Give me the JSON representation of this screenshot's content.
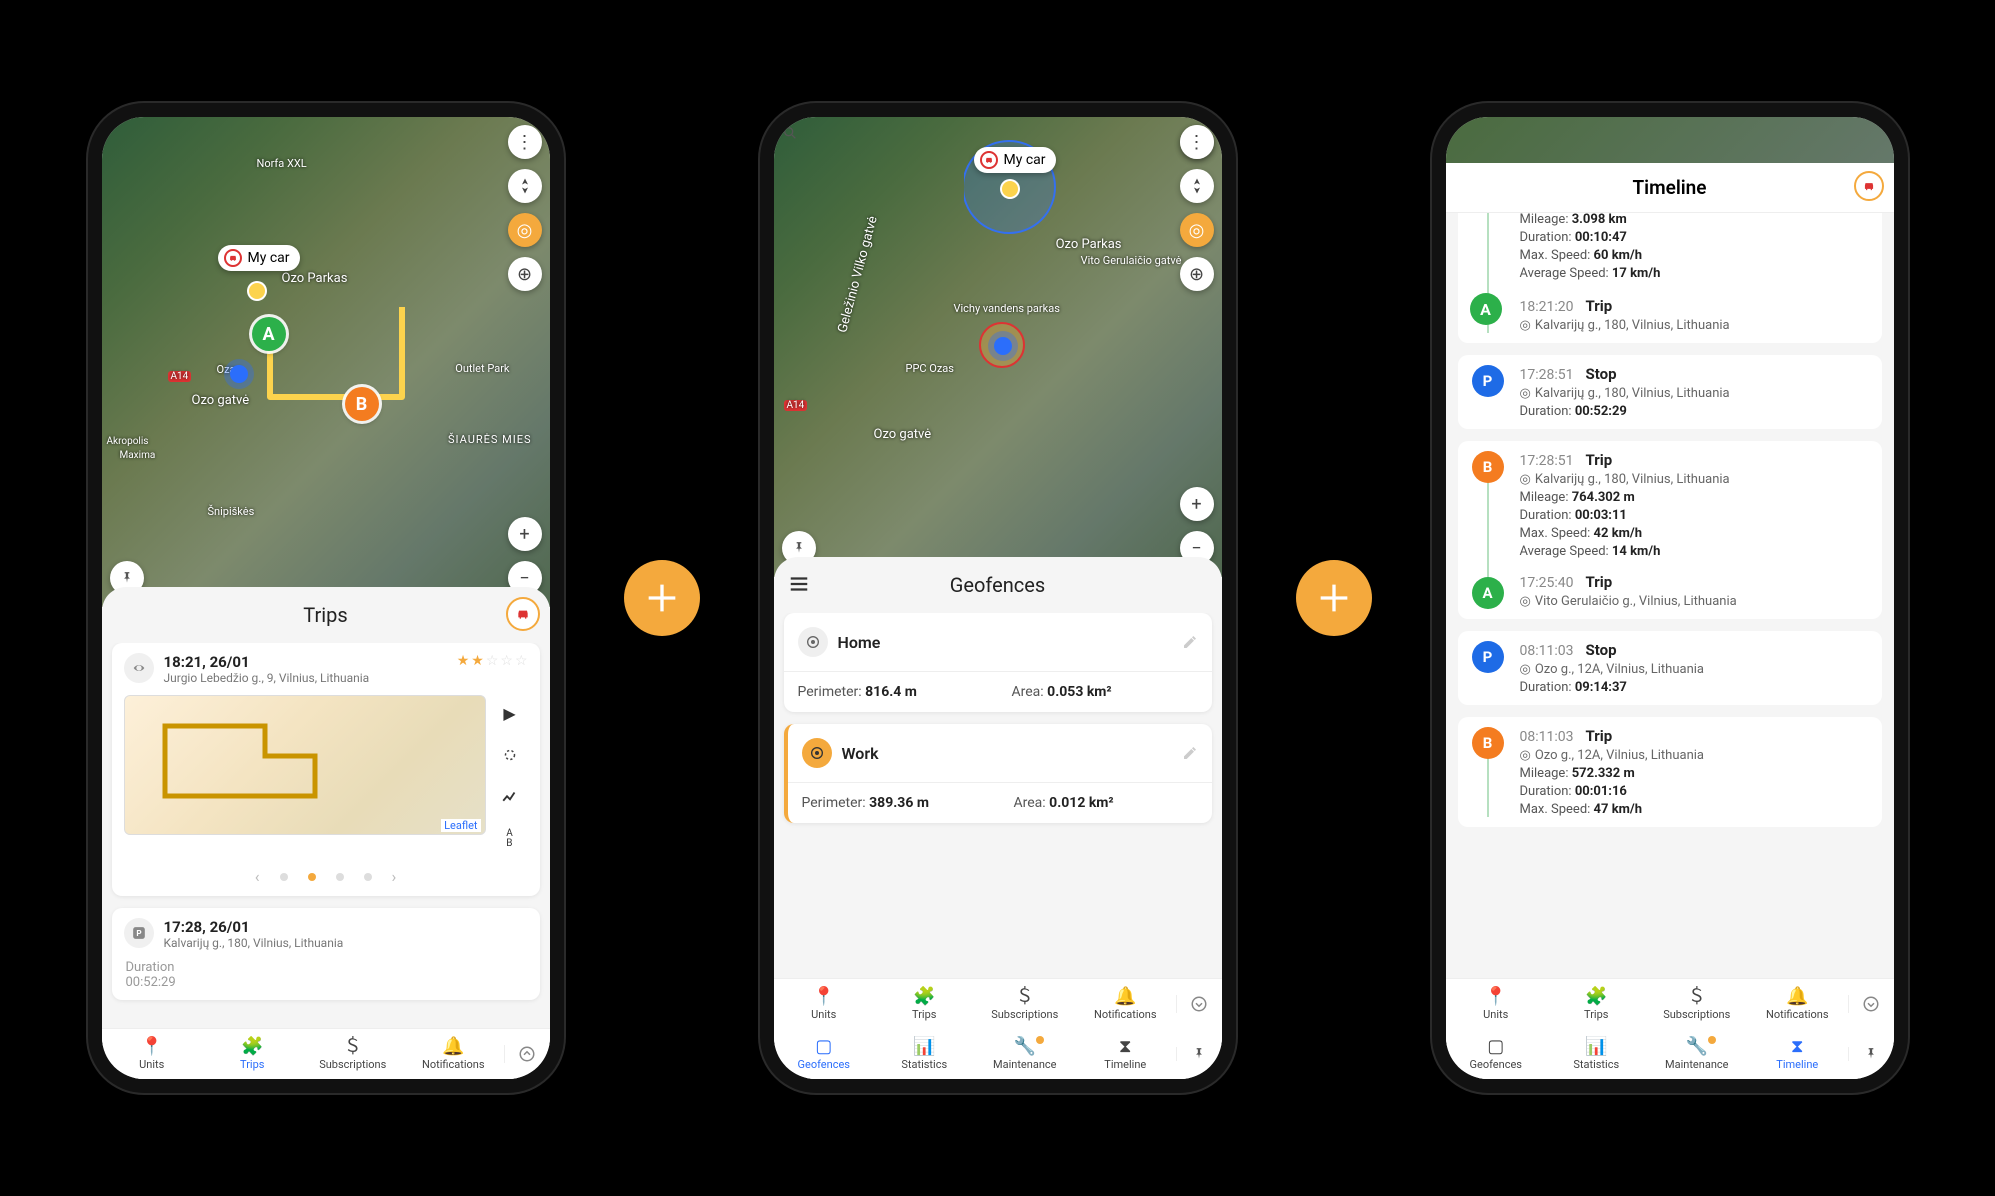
{
  "phone1": {
    "unit_bubble": "My car",
    "panel_title": "Trips",
    "map_labels": {
      "ozo": "Ozo Parkas",
      "ozas": "Ozas",
      "ozo_g": "Ozo gatvė",
      "outlet": "Outlet Park",
      "snip": "Šnipiškės",
      "akropolis": "Akropolis",
      "maxima": "Maxima",
      "siaures": "ŠIAURĖS MIES",
      "norfa": "Norfa XXL",
      "a14": "A14"
    },
    "trip1": {
      "time": "18:21, 26/01",
      "addr": "Jurgio Lebedžio g., 9, Vilnius, Lithuania",
      "leaflet": "Leaflet",
      "ab": "A\nB"
    },
    "trip2": {
      "time": "17:28, 26/01",
      "addr": "Kalvarijų g., 180, Vilnius, Lithuania",
      "duration_label": "Duration",
      "duration_value": "00:52:29"
    },
    "nav": {
      "units": "Units",
      "trips": "Trips",
      "subs": "Subscriptions",
      "notif": "Notifications"
    }
  },
  "phone2": {
    "unit_bubble": "My car",
    "panel_title": "Geofences",
    "map_labels": {
      "ozo": "Ozo Parkas",
      "vichy": "Vichy vandens parkas",
      "ppc": "PPC Ozas",
      "ozo_g": "Ozo gatvė",
      "gelezinio": "Geležinio Vilko gatvė",
      "vito": "Vito Gerulaičio gatvė",
      "a14": "A14"
    },
    "geo1": {
      "name": "Home",
      "peri_label": "Perimeter: ",
      "peri_val": "816.4 m",
      "area_label": "Area: ",
      "area_val": "0.053 km²"
    },
    "geo2": {
      "name": "Work",
      "peri_label": "Perimeter: ",
      "peri_val": "389.36 m",
      "area_label": "Area: ",
      "area_val": "0.012 km²"
    },
    "nav": {
      "units": "Units",
      "trips": "Trips",
      "subs": "Subscriptions",
      "notif": "Notifications",
      "geof": "Geofences",
      "stats": "Statistics",
      "maint": "Maintenance",
      "timeline": "Timeline"
    }
  },
  "phone3": {
    "header": "Timeline",
    "partial": {
      "mileage_l": "Mileage: ",
      "mileage_v": "3.098 km",
      "duration_l": "Duration: ",
      "duration_v": "00:10:47",
      "maxspeed_l": "Max. Speed: ",
      "maxspeed_v": "60 km/h",
      "avgspeed_l": "Average Speed: ",
      "avgspeed_v": "17 km/h"
    },
    "ev1": {
      "time": "18:21:20",
      "type": "Trip",
      "addr": "Kalvarijų g., 180, Vilnius, Lithuania"
    },
    "ev2": {
      "time": "17:28:51",
      "type": "Stop",
      "addr": "Kalvarijų g., 180, Vilnius, Lithuania",
      "dur_l": "Duration: ",
      "dur_v": "00:52:29"
    },
    "ev3": {
      "time": "17:28:51",
      "type": "Trip",
      "addr": "Kalvarijų g., 180, Vilnius, Lithuania",
      "mileage_l": "Mileage: ",
      "mileage_v": "764.302 m",
      "duration_l": "Duration: ",
      "duration_v": "00:03:11",
      "maxspeed_l": "Max. Speed: ",
      "maxspeed_v": "42 km/h",
      "avgspeed_l": "Average Speed: ",
      "avgspeed_v": "14 km/h"
    },
    "ev3b": {
      "time": "17:25:40",
      "type": "Trip",
      "addr": "Vito Gerulaičio g., Vilnius, Lithuania"
    },
    "ev4": {
      "time": "08:11:03",
      "type": "Stop",
      "addr": "Ozo g., 12A, Vilnius, Lithuania",
      "dur_l": "Duration: ",
      "dur_v": "09:14:37"
    },
    "ev5": {
      "time": "08:11:03",
      "type": "Trip",
      "addr": "Ozo g., 12A, Vilnius, Lithuania",
      "mileage_l": "Mileage: ",
      "mileage_v": "572.332 m",
      "duration_l": "Duration: ",
      "duration_v": "00:01:16",
      "maxspeed_l": "Max. Speed: ",
      "maxspeed_v": "47 km/h"
    },
    "nav": {
      "units": "Units",
      "trips": "Trips",
      "subs": "Subscriptions",
      "notif": "Notifications",
      "geof": "Geofences",
      "stats": "Statistics",
      "maint": "Maintenance",
      "timeline": "Timeline"
    }
  }
}
